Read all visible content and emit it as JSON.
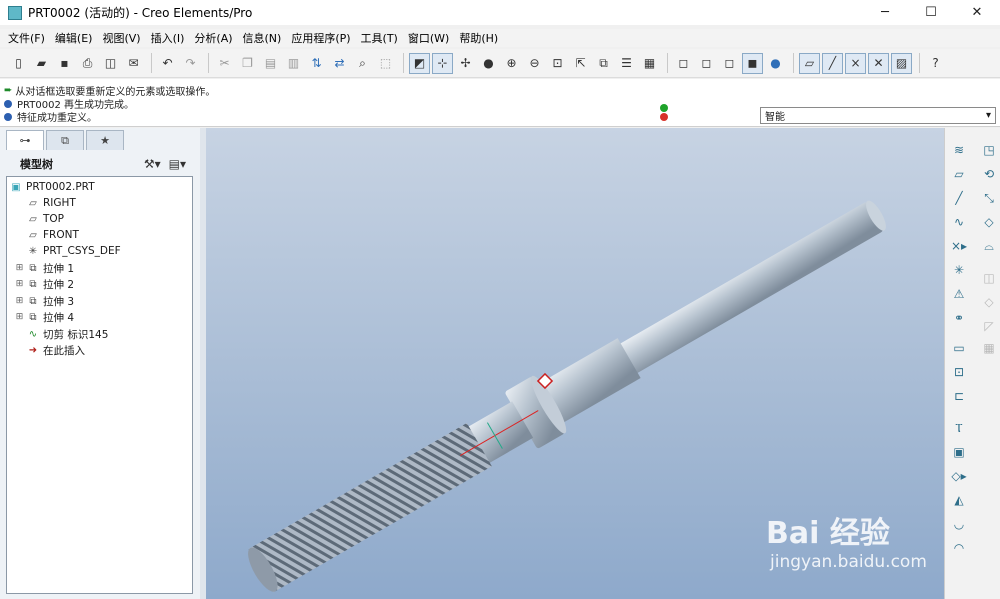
{
  "window": {
    "title": "PRT0002 (活动的) - Creo Elements/Pro",
    "controls": {
      "minimize": "─",
      "maximize": "☐",
      "close": "✕"
    }
  },
  "menu": [
    "文件(F)",
    "编辑(E)",
    "视图(V)",
    "插入(I)",
    "分析(A)",
    "信息(N)",
    "应用程序(P)",
    "工具(T)",
    "窗口(W)",
    "帮助(H)"
  ],
  "toolbar": {
    "icons": [
      "new-icon",
      "open-icon",
      "save-icon",
      "print-icon",
      "print-preview-icon",
      "email-icon",
      "undo-icon",
      "redo-icon",
      "cut-icon",
      "copy-icon",
      "paste-icon",
      "paste-special-icon",
      "regenerate-icon",
      "regen-manager-icon",
      "find-icon",
      "select-box-icon",
      "repaint-icon",
      "spin-center-icon",
      "orient-icon",
      "appearance-icon",
      "zoom-in-icon",
      "zoom-out-icon",
      "refit-icon",
      "reorient-icon",
      "saved-views-icon",
      "layers-icon",
      "wireframe-icon",
      "hidden-line-icon",
      "no-hidden-icon",
      "shading-icon",
      "enhanced-realism-icon",
      "datum-planes-icon",
      "datum-axes-icon",
      "datum-points-icon",
      "csys-icon",
      "whats-this-icon"
    ]
  },
  "messages": [
    {
      "type": "prompt",
      "text": "从对话框选取要重新定义的元素或选取操作。"
    },
    {
      "type": "info",
      "text": "PRT0002 再生成功完成。"
    },
    {
      "type": "info",
      "text": "特征成功重定义。"
    }
  ],
  "filter": {
    "value": "智能"
  },
  "model_tree": {
    "title": "模型树",
    "items": [
      {
        "label": "PRT0002.PRT",
        "icon": "part-icon",
        "level": 0,
        "expandable": false
      },
      {
        "label": "RIGHT",
        "icon": "datum-plane-icon",
        "level": 1,
        "expandable": false
      },
      {
        "label": "TOP",
        "icon": "datum-plane-icon",
        "level": 1,
        "expandable": false
      },
      {
        "label": "FRONT",
        "icon": "datum-plane-icon",
        "level": 1,
        "expandable": false
      },
      {
        "label": "PRT_CSYS_DEF",
        "icon": "csys-icon",
        "level": 1,
        "expandable": false
      },
      {
        "label": "拉伸 1",
        "icon": "extrude-icon",
        "level": 1,
        "expandable": true
      },
      {
        "label": "拉伸 2",
        "icon": "extrude-icon",
        "level": 1,
        "expandable": true
      },
      {
        "label": "拉伸 3",
        "icon": "extrude-icon",
        "level": 1,
        "expandable": true
      },
      {
        "label": "拉伸 4",
        "icon": "extrude-icon",
        "level": 1,
        "expandable": true
      },
      {
        "label": "切剪 标识145",
        "icon": "helical-sweep-icon",
        "level": 1,
        "expandable": false
      },
      {
        "label": "在此插入",
        "icon": "insert-here-icon",
        "level": 1,
        "expandable": false
      }
    ]
  },
  "watermark": {
    "brand": "Bai 经验",
    "url": "jingyan.baidu.com"
  }
}
